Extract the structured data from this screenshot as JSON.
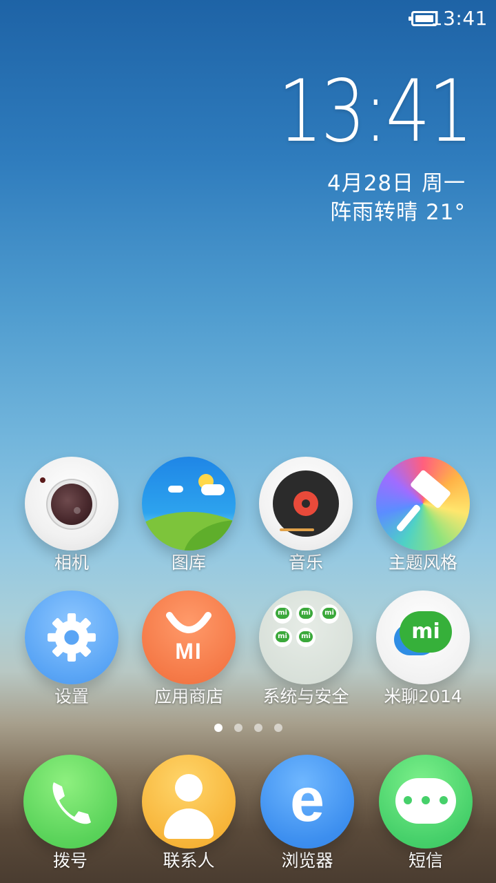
{
  "status_bar": {
    "time": "13:41",
    "battery_icon": "battery-full-icon"
  },
  "clock_widget": {
    "time": "13:41",
    "date": "4月28日 周一",
    "weather": "阵雨转晴  21°"
  },
  "apps": [
    {
      "label": "相机",
      "icon": "camera-icon"
    },
    {
      "label": "图库",
      "icon": "gallery-icon"
    },
    {
      "label": "音乐",
      "icon": "music-icon"
    },
    {
      "label": "主题风格",
      "icon": "themes-icon"
    },
    {
      "label": "设置",
      "icon": "settings-gear-icon"
    },
    {
      "label": "应用商店",
      "icon": "app-store-icon",
      "logo_text": "MI"
    },
    {
      "label": "系统与安全",
      "icon": "folder-icon"
    },
    {
      "label": "米聊2014",
      "icon": "mitalk-icon",
      "logo_text": "mi"
    }
  ],
  "page_indicator": {
    "total": 4,
    "active": 1
  },
  "dock": [
    {
      "label": "拨号",
      "icon": "phone-icon"
    },
    {
      "label": "联系人",
      "icon": "contacts-icon"
    },
    {
      "label": "浏览器",
      "icon": "browser-icon"
    },
    {
      "label": "短信",
      "icon": "messages-icon"
    }
  ],
  "colors": {
    "sky_top": "#1e63a6",
    "sky_mid": "#73b6dc",
    "ground": "#4a3c30"
  }
}
